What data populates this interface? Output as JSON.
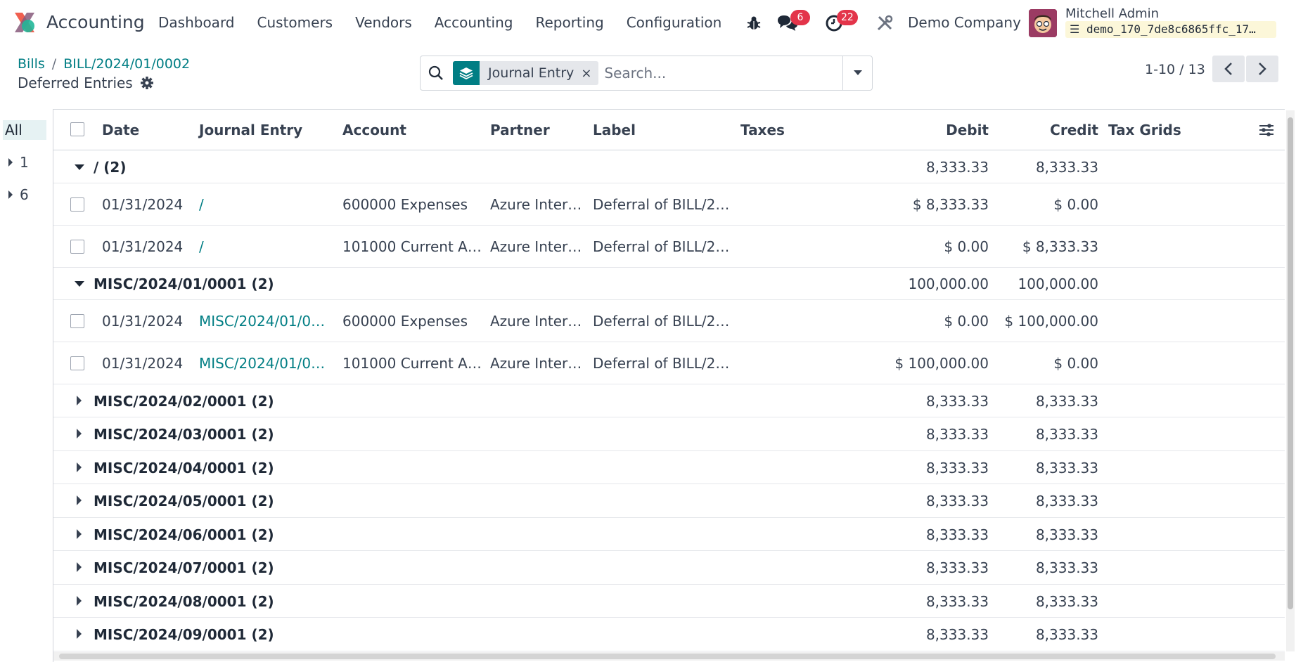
{
  "navbar": {
    "app_name": "Accounting",
    "menu": [
      "Dashboard",
      "Customers",
      "Vendors",
      "Accounting",
      "Reporting",
      "Configuration"
    ],
    "chat_badge": "6",
    "activity_badge": "22",
    "company": "Demo Company",
    "user_name": "Mitchell Admin",
    "database": "demo_170_7de8c6865ffc_17…"
  },
  "breadcrumb": {
    "parent": "Bills",
    "current": "BILL/2024/01/0002",
    "separator": "/"
  },
  "subtitle": "Deferred Entries",
  "search": {
    "facet_label": "Journal Entry",
    "facet_close": "×",
    "placeholder": "Search..."
  },
  "pager": {
    "value": "1-10 / 13"
  },
  "side_panel": {
    "items": [
      {
        "label": "All",
        "active": true
      },
      {
        "label": "1",
        "active": false
      },
      {
        "label": "6",
        "active": false
      }
    ]
  },
  "table": {
    "headers": {
      "date": "Date",
      "journal_entry": "Journal Entry",
      "account": "Account",
      "partner": "Partner",
      "label": "Label",
      "taxes": "Taxes",
      "debit": "Debit",
      "credit": "Credit",
      "tax_grids": "Tax Grids"
    },
    "groups": [
      {
        "name": "/ (2)",
        "debit": "8,333.33",
        "credit": "8,333.33",
        "expanded": true,
        "rows": [
          {
            "date": "01/31/2024",
            "journal_entry": "/",
            "account": "600000 Expenses",
            "partner": "Azure Inter…",
            "label": "Deferral of BILL/2…",
            "debit": "$ 8,333.33",
            "credit": "$ 0.00"
          },
          {
            "date": "01/31/2024",
            "journal_entry": "/",
            "account": "101000 Current A…",
            "partner": "Azure Inter…",
            "label": "Deferral of BILL/2…",
            "debit": "$ 0.00",
            "credit": "$ 8,333.33"
          }
        ]
      },
      {
        "name": "MISC/2024/01/0001 (2)",
        "debit": "100,000.00",
        "credit": "100,000.00",
        "expanded": true,
        "rows": [
          {
            "date": "01/31/2024",
            "journal_entry": "MISC/2024/01/00…",
            "account": "600000 Expenses",
            "partner": "Azure Inter…",
            "label": "Deferral of BILL/2…",
            "debit": "$ 0.00",
            "credit": "$ 100,000.00"
          },
          {
            "date": "01/31/2024",
            "journal_entry": "MISC/2024/01/00…",
            "account": "101000 Current A…",
            "partner": "Azure Inter…",
            "label": "Deferral of BILL/2…",
            "debit": "$ 100,000.00",
            "credit": "$ 0.00"
          }
        ]
      },
      {
        "name": "MISC/2024/02/0001 (2)",
        "debit": "8,333.33",
        "credit": "8,333.33",
        "expanded": false,
        "rows": []
      },
      {
        "name": "MISC/2024/03/0001 (2)",
        "debit": "8,333.33",
        "credit": "8,333.33",
        "expanded": false,
        "rows": []
      },
      {
        "name": "MISC/2024/04/0001 (2)",
        "debit": "8,333.33",
        "credit": "8,333.33",
        "expanded": false,
        "rows": []
      },
      {
        "name": "MISC/2024/05/0001 (2)",
        "debit": "8,333.33",
        "credit": "8,333.33",
        "expanded": false,
        "rows": []
      },
      {
        "name": "MISC/2024/06/0001 (2)",
        "debit": "8,333.33",
        "credit": "8,333.33",
        "expanded": false,
        "rows": []
      },
      {
        "name": "MISC/2024/07/0001 (2)",
        "debit": "8,333.33",
        "credit": "8,333.33",
        "expanded": false,
        "rows": []
      },
      {
        "name": "MISC/2024/08/0001 (2)",
        "debit": "8,333.33",
        "credit": "8,333.33",
        "expanded": false,
        "rows": []
      },
      {
        "name": "MISC/2024/09/0001 (2)",
        "debit": "8,333.33",
        "credit": "8,333.33",
        "expanded": false,
        "rows": []
      }
    ]
  },
  "colors": {
    "brand": "#017e84",
    "badge": "#e3344a",
    "text": "#374151"
  },
  "icons": {
    "app_logo": "accounting-logo-icon",
    "bug": "bug-icon",
    "chat": "chat-icon",
    "activity": "clock-icon",
    "tools": "tools-icon",
    "gear": "gear-icon",
    "search": "search-icon",
    "facet": "layers-icon",
    "settings_columns": "sliders-icon"
  }
}
